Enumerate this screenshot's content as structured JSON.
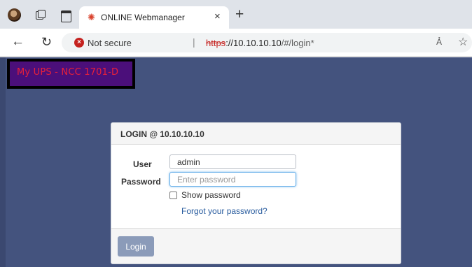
{
  "browser": {
    "tab": {
      "favicon": "✺",
      "title": "ONLINE Webmanager",
      "close": "×"
    },
    "new_tab": "+",
    "nav": {
      "back": "←",
      "refresh": "↻"
    },
    "address": {
      "security_icon": "×",
      "security_text": "Not secure",
      "separator": "|",
      "protocol": "https",
      "host": "://10.10.10.10",
      "path": "/#/login*"
    },
    "read_aloud": "Ả",
    "favorite": "☆"
  },
  "page": {
    "banner_title": "My UPS - NCC 1701-D",
    "login": {
      "header": "LOGIN @ 10.10.10.10",
      "user_label": "User",
      "user_value": "admin",
      "password_label": "Password",
      "password_placeholder": "Enter password",
      "show_password_label": "Show password",
      "forgot_link": "Forgot your password?",
      "login_button": "Login"
    }
  },
  "colors": {
    "page_background": "#44537e",
    "banner_background": "#4b0f7a",
    "banner_text": "#e8203a",
    "login_button": "#8b9bb9",
    "link": "#2a5d9f",
    "insecure": "#c5221f"
  }
}
